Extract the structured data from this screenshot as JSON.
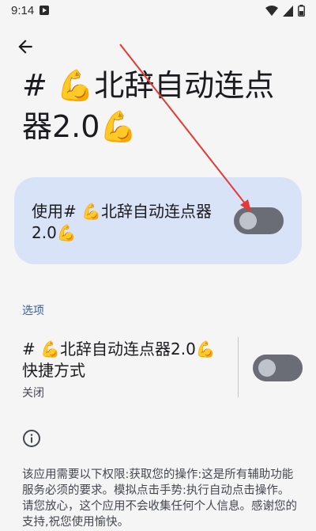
{
  "status_bar": {
    "time": "9:14",
    "icons": [
      "app-notification-icon",
      "wifi-icon",
      "cellular-signal-icon",
      "battery-icon"
    ]
  },
  "toolbar": {
    "back_icon": "arrow-left-icon"
  },
  "page": {
    "title": "# 💪北辞自动连点器2.0💪"
  },
  "main_switch": {
    "label": "使用# 💪北辞自动连点器2.0💪",
    "state": "off"
  },
  "options": {
    "section_label": "选项",
    "shortcut": {
      "title": "# 💪北辞自动连点器2.0💪快捷方式",
      "status": "关闭",
      "state": "off"
    }
  },
  "info": {
    "icon": "info-icon",
    "description": "该应用需要以下权限:获取您的操作:这是所有辅助功能服务必须的要求。模拟点击手势:执行自动点击操作。请您放心，这个应用不会收集任何个人信息。感谢您的支持,祝您使用愉快。"
  },
  "colors": {
    "card": "#d9e3f7",
    "accent": "#3b5e9a",
    "annotation": "#e53935"
  }
}
